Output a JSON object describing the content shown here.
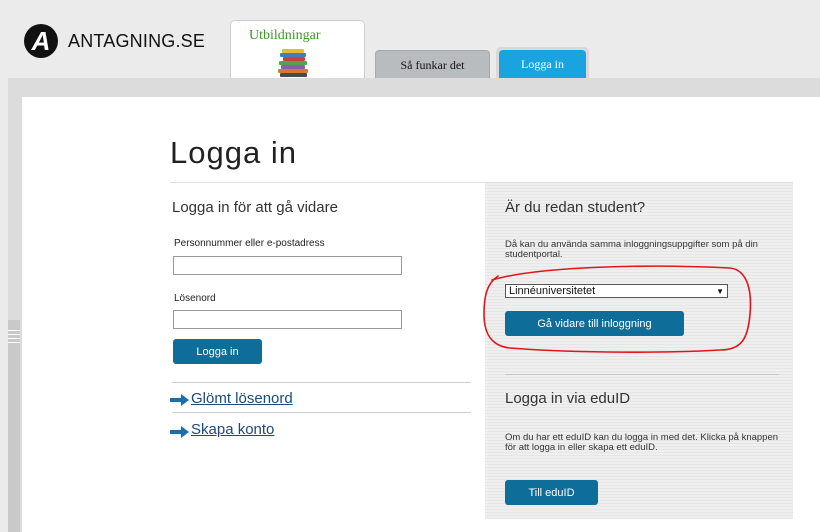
{
  "header": {
    "logo_letter": "A",
    "site_name": "ANTAGNING.SE",
    "tabs": {
      "utbildningar": "Utbildningar",
      "sa_funkar_det": "Så funkar det",
      "logga_in": "Logga in"
    }
  },
  "page": {
    "title": "Logga in"
  },
  "login_form": {
    "heading": "Logga in för att gå vidare",
    "username_label": "Personnummer eller e-postadress",
    "username_value": "",
    "password_label": "Lösenord",
    "password_value": "",
    "submit_label": "Logga in"
  },
  "links": {
    "forgot_password": "Glömt lösenord",
    "create_account": "Skapa konto"
  },
  "student_section": {
    "heading": "Är du redan student?",
    "description": "Då kan du använda samma inloggningsuppgifter som på din studentportal.",
    "selected_university": "Linnéuniversitetet",
    "continue_button": "Gå vidare till inloggning"
  },
  "eduid_section": {
    "heading": "Logga in via eduID",
    "description": "Om du har ett eduID kan du logga in med det. Klicka på knappen för att logga in eller skapa ett eduID.",
    "button": "Till eduID"
  },
  "colors": {
    "accent_tab": "#19a4df",
    "button": "#0e6d99",
    "annotation": "#e0161b",
    "link": "#1a4b7a",
    "arrow": "#1a6fa8"
  }
}
